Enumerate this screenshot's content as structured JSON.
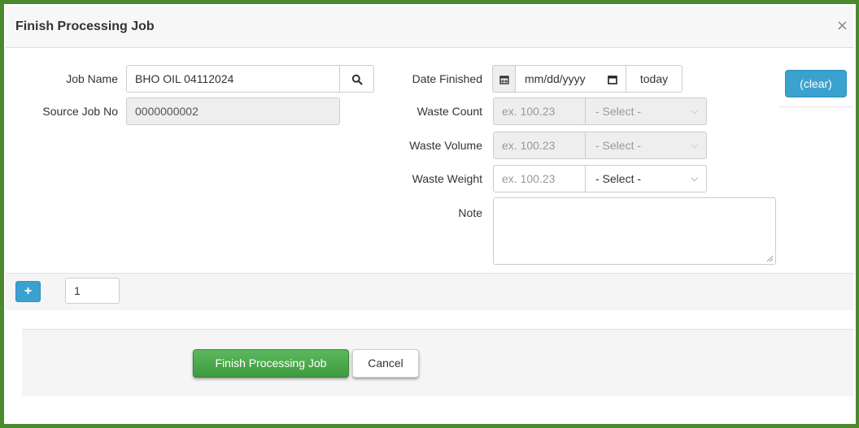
{
  "dialog": {
    "title": "Finish Processing Job",
    "close_glyph": "×"
  },
  "left": {
    "job_name_label": "Job Name",
    "job_name_value": "BHO OIL 04112024",
    "source_job_label": "Source Job No",
    "source_job_value": "0000000002"
  },
  "right": {
    "date_finished_label": "Date Finished",
    "date_placeholder": "mm/dd/yyyy",
    "today_label": "today",
    "waste_count_label": "Waste Count",
    "waste_count_placeholder": "ex. 100.23",
    "waste_count_unit": "- Select -",
    "waste_volume_label": "Waste Volume",
    "waste_volume_placeholder": "ex. 100.23",
    "waste_volume_unit": "- Select -",
    "waste_weight_label": "Waste Weight",
    "waste_weight_placeholder": "ex. 100.23",
    "waste_weight_unit": "- Select -",
    "note_label": "Note",
    "clear_label": "(clear)"
  },
  "strip": {
    "plus_label": "+",
    "count_value": "1"
  },
  "footer": {
    "finish_label": "Finish Processing Job",
    "cancel_label": "Cancel"
  },
  "colors": {
    "frame_border": "#4b8a2c",
    "primary_blue": "#3ba2cf",
    "success_green": "#5cb85c"
  }
}
